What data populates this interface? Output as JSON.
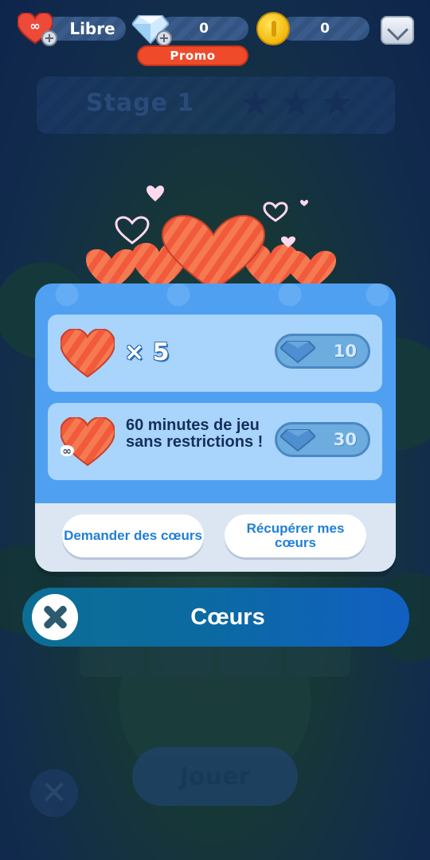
{
  "hud": {
    "lives_label": "Libre",
    "gems_count": "0",
    "coins_count": "0",
    "promo_label": "Promo"
  },
  "stage": {
    "label": "Stage 1",
    "stars": [
      "★",
      "★",
      "★"
    ]
  },
  "dialog": {
    "offers": [
      {
        "quantity": "× 5",
        "price": "10",
        "icon": "heart-icon"
      },
      {
        "description": "60 minutes de jeu sans restrictions !",
        "price": "30",
        "icon": "infinite-heart-icon"
      }
    ],
    "ask_button": "Demander des cœurs",
    "recover_button": "Récupérer mes cœurs"
  },
  "title": "Cœurs",
  "background": {
    "play_label": "Jouer"
  },
  "colors": {
    "dialog_blue": "#4fa0f1",
    "offer_card": "#a9d4fb",
    "button_text": "#1f7fd6",
    "heart_red": "#f25a3c",
    "promo_red": "#ef4a2a"
  }
}
